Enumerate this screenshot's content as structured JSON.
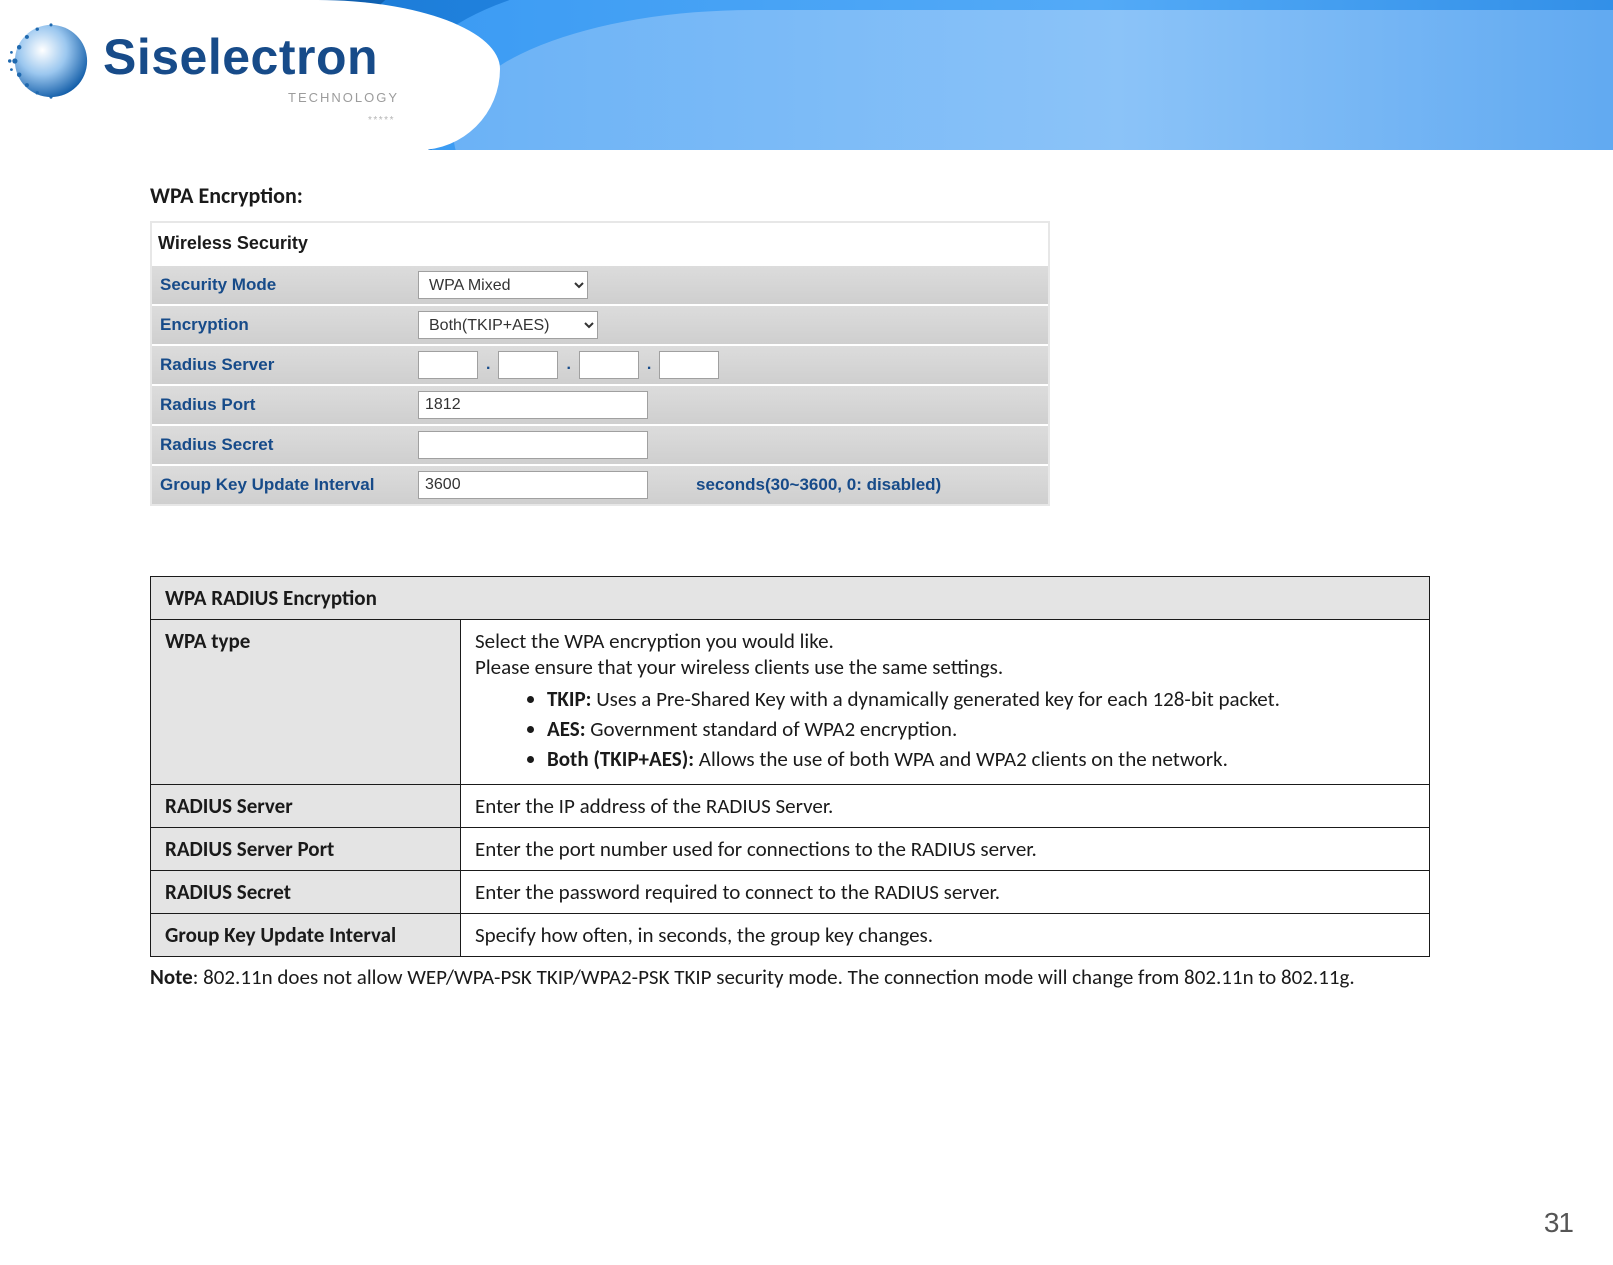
{
  "brand": {
    "name": "Siselectron",
    "subtitle": "TECHNOLOGY",
    "dots": "*****"
  },
  "section_heading": "WPA Encryption:",
  "config": {
    "caption": "Wireless Security",
    "rows": {
      "security_mode": {
        "label": "Security Mode",
        "value": "WPA Mixed"
      },
      "encryption": {
        "label": "Encryption",
        "value": "Both(TKIP+AES)"
      },
      "radius_server": {
        "label": "Radius Server",
        "ip": [
          "",
          "",
          "",
          ""
        ]
      },
      "radius_port": {
        "label": "Radius Port",
        "value": "1812"
      },
      "radius_secret": {
        "label": "Radius Secret",
        "value": ""
      },
      "group_key": {
        "label": "Group Key Update Interval",
        "value": "3600",
        "hint": "seconds(30~3600, 0: disabled)"
      }
    }
  },
  "table": {
    "header": "WPA RADIUS Encryption",
    "rows": [
      {
        "name": "WPA type",
        "body": {
          "lead1": "Select the WPA encryption you would like.",
          "lead2": "Please ensure that your wireless clients use the same settings.",
          "items": [
            {
              "term": "TKIP:",
              "desc": " Uses a Pre-Shared Key with a dynamically generated key for each 128-bit packet."
            },
            {
              "term": "AES:",
              "desc": " Government standard of WPA2 encryption."
            },
            {
              "term": "Both (TKIP+AES):",
              "desc": " Allows the use of both WPA and WPA2 clients on the network."
            }
          ]
        }
      },
      {
        "name": "RADIUS Server",
        "desc": "Enter the IP address of the RADIUS Server."
      },
      {
        "name": "RADIUS Server Port",
        "desc": "Enter the port number used for connections to the RADIUS server."
      },
      {
        "name": "RADIUS Secret",
        "desc": "Enter the password required to connect to the RADIUS server."
      },
      {
        "name": "Group Key Update Interval",
        "desc": "Specify how often, in seconds, the group key changes."
      }
    ]
  },
  "note": {
    "label": "Note",
    "text": ":  802.11n does not allow WEP/WPA-PSK TKIP/WPA2-PSK TKIP security mode. The connection mode will change from 802.11n to 802.11g."
  },
  "page_number": "31"
}
